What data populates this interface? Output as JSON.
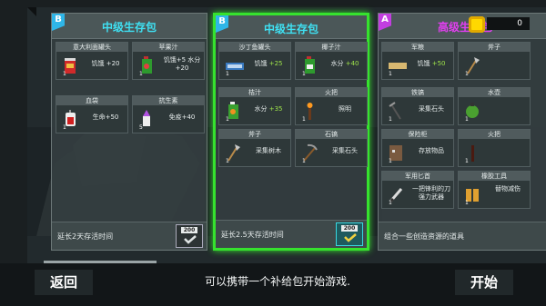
{
  "coins": {
    "count": "0",
    "icon": "gold-coin-icon"
  },
  "packs": [
    {
      "badge": "B",
      "badge_color": "#2fb6e8",
      "title": "中级生存包",
      "title_color": "#3fe0f2",
      "selected": false,
      "items": [
        {
          "name": "意大利面罐头",
          "stat": "饥饿 +20",
          "icon": "pasta-can-icon",
          "count": "1"
        },
        {
          "name": "苹果汁",
          "stat": "饥饿+5 水分+20",
          "icon": "apple-juice-icon",
          "count": "1"
        },
        {
          "name": "血袋",
          "stat": "生命+50",
          "icon": "blood-bag-icon",
          "count": "1"
        },
        {
          "name": "抗生素",
          "stat": "免疫+40",
          "icon": "antibiotics-icon",
          "count": "5"
        }
      ],
      "footer": "延长2天存活时间",
      "button_value": "200"
    },
    {
      "badge": "B",
      "badge_color": "#2fb6e8",
      "title": "中级生存包",
      "title_color": "#3fe0f2",
      "selected": true,
      "items": [
        {
          "name": "沙丁鱼罐头",
          "stat_label": "饥饿",
          "stat_value": "+25",
          "icon": "sardine-can-icon",
          "count": "1"
        },
        {
          "name": "椰子汁",
          "stat_label": "水分",
          "stat_value": "+40",
          "icon": "coconut-juice-icon",
          "count": "1"
        },
        {
          "name": "桔汁",
          "stat_label": "水分",
          "stat_value": "+35",
          "icon": "orange-juice-icon",
          "count": "1"
        },
        {
          "name": "火把",
          "stat": "照明",
          "icon": "torch-icon",
          "count": "1"
        },
        {
          "name": "斧子",
          "stat": "采集树木",
          "icon": "axe-icon",
          "count": "1"
        },
        {
          "name": "石镐",
          "stat": "采集石头",
          "icon": "pickaxe-icon",
          "count": "1"
        }
      ],
      "footer": "延长2.5天存活时间",
      "button_value": "200"
    },
    {
      "badge": "A",
      "badge_color": "#c23ee0",
      "title": "高级生存包",
      "title_color": "#e23ff0",
      "selected": false,
      "items": [
        {
          "name": "军粮",
          "stat_label": "饥饿",
          "stat_value": "+50",
          "icon": "ration-icon",
          "count": "1"
        },
        {
          "name": "斧子",
          "stat": "",
          "icon": "axe-icon",
          "count": "1"
        },
        {
          "name": "铁镐",
          "stat": "采集石头",
          "icon": "iron-pickaxe-icon",
          "count": "1"
        },
        {
          "name": "水壶",
          "stat": "",
          "icon": "canteen-icon",
          "count": "1"
        },
        {
          "name": "保险柜",
          "stat": "存放物品",
          "icon": "safe-icon",
          "count": "1"
        },
        {
          "name": "火把",
          "stat": "",
          "icon": "torch-icon",
          "count": "1"
        },
        {
          "name": "军用匕首",
          "stat": "一把锋利的刀 强力武器",
          "icon": "knife-icon",
          "count": "1"
        },
        {
          "name": "橡胶工具",
          "stat": "替物减伤",
          "icon": "rubber-tool-icon",
          "count": "1"
        }
      ],
      "footer": "组合一些创造资源的道具"
    }
  ],
  "bottom": {
    "back_label": "返回",
    "hint": "可以携带一个补给包开始游戏.",
    "start_label": "开始"
  }
}
